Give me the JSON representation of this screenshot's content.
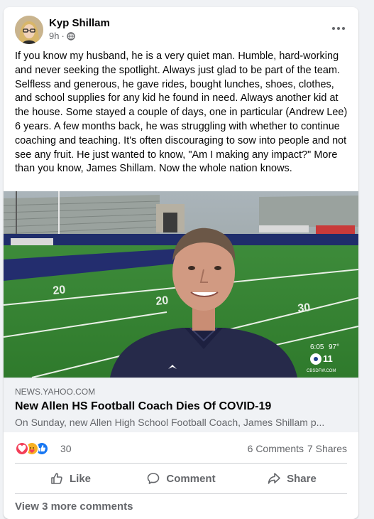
{
  "post": {
    "author": "Kyp Shillam",
    "time": "9h",
    "privacy_icon": "globe-icon",
    "more_icon": "more-options-icon",
    "text": "If you know my husband, he is a very quiet man. Humble, hard-working and never seeking the spotlight. Always just glad to be part of the team. Selfless and generous, he gave rides, bought lunches, shoes, clothes, and school supplies for any kid he found in need. Always another kid at the house. Some stayed a couple of days, one in particular (Andrew Lee) 6 years. A few months back, he was struggling with whether to continue coaching and teaching. It's often discouraging to sow into people and not see any fruit. He just wanted to know, \"Am I making any impact?\" More than you know, James Shillam. Now the whole nation knows."
  },
  "video": {
    "clock": "6:05",
    "temp": "97°",
    "station": "CBSDFW.COM",
    "field_numbers": [
      "20",
      "20",
      "30"
    ]
  },
  "link": {
    "domain": "NEWS.YAHOO.COM",
    "title": "New Allen HS Football Coach Dies Of COVID-19",
    "description": "On Sunday, new Allen High School Football Coach, James Shillam p..."
  },
  "stats": {
    "reaction_count": "30",
    "reactions": [
      "love",
      "care",
      "like"
    ],
    "comments": "6 Comments",
    "shares": "7 Shares"
  },
  "actions": {
    "like": "Like",
    "comment": "Comment",
    "share": "Share"
  },
  "footer": {
    "view_more": "View 3 more comments"
  },
  "colors": {
    "like_blue": "#1877f2",
    "love_red": "#f33e58",
    "care_yellow": "#f7b125",
    "secondary_text": "#65676b"
  }
}
